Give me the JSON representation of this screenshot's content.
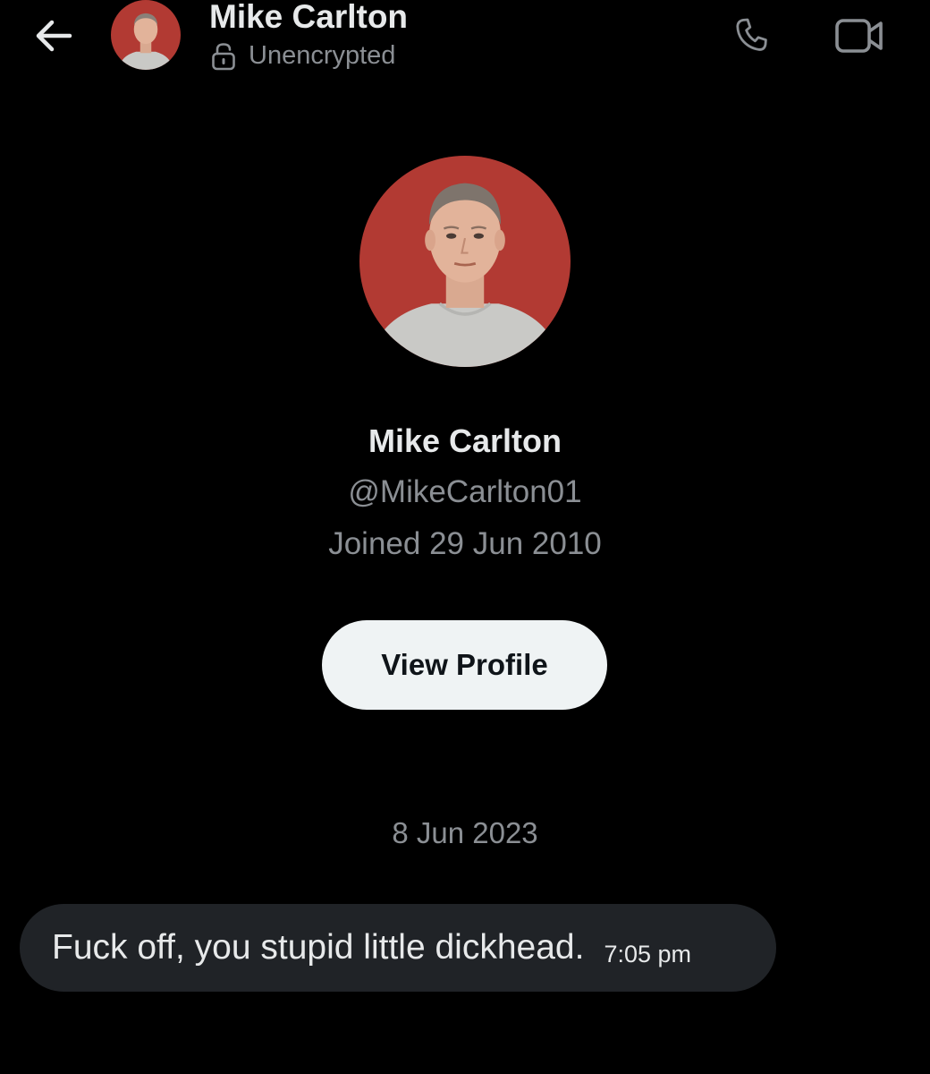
{
  "header": {
    "back_icon": "arrow-left-icon",
    "name": "Mike Carlton",
    "encryption_status": "Unencrypted",
    "lock_icon": "unlocked-padlock-icon",
    "call_icon": "phone-icon",
    "video_icon": "video-camera-icon"
  },
  "profile": {
    "name": "Mike Carlton",
    "handle": "@MikeCarlton01",
    "joined": "Joined 29 Jun 2010",
    "view_profile_label": "View Profile"
  },
  "conversation": {
    "date_separator": "8 Jun 2023",
    "messages": [
      {
        "text": "Fuck off, you stupid little dickhead.",
        "time": "7:05 pm"
      }
    ]
  },
  "colors": {
    "background": "#000000",
    "primary_text": "#e7e9ea",
    "secondary_text": "#8b8f94",
    "button_bg": "#eff3f4",
    "bubble_bg": "#202327",
    "avatar_bg": "#b23a33"
  }
}
